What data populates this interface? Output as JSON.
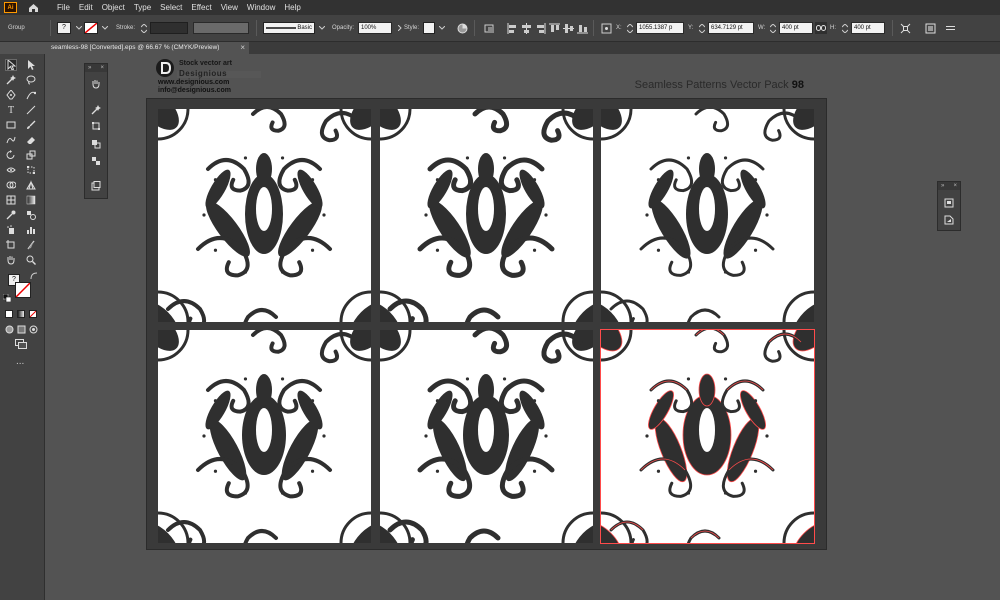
{
  "app": {
    "logo_text": "Ai",
    "menus": [
      "File",
      "Edit",
      "Object",
      "Type",
      "Select",
      "Effect",
      "View",
      "Window",
      "Help"
    ]
  },
  "control_bar": {
    "selection_type": "Group",
    "stroke_label": "Stroke:",
    "brush_label": "Basic",
    "opacity_label": "Opacity:",
    "opacity_value": "100%",
    "style_label": "Style:",
    "x_label": "X:",
    "x_value": "1055.1387 p",
    "y_label": "Y:",
    "y_value": "634.7129 pt",
    "w_label": "W:",
    "w_value": "400 pt",
    "h_label": "H:",
    "h_value": "400 pt"
  },
  "document": {
    "tab_title": "seamless-98 [Converted].eps @ 66.67 % (CMYK/Preview)",
    "close_glyph": "×"
  },
  "artboard": {
    "brand_title": "Stock vector art",
    "brand_name": "Designious",
    "website": "www.designious.com",
    "email": "info@designious.com",
    "pack_title": "Seamless Patterns Vector Pack",
    "pack_number": "98",
    "tiles": [
      {
        "name": "pattern-tile-1",
        "variant": 1,
        "selected": false
      },
      {
        "name": "pattern-tile-2",
        "variant": 2,
        "selected": false
      },
      {
        "name": "pattern-tile-3",
        "variant": 3,
        "selected": false
      },
      {
        "name": "pattern-tile-4",
        "variant": 4,
        "selected": false
      },
      {
        "name": "pattern-tile-5",
        "variant": 5,
        "selected": false
      },
      {
        "name": "pattern-tile-6",
        "variant": 6,
        "selected": true
      }
    ]
  },
  "colors": {
    "ink": "#2f2f2f",
    "selection": "#ff4b4b",
    "app_accent": "#ff9a00"
  },
  "tools": {
    "stroke_fill_value": "?",
    "more_tools": "..."
  }
}
